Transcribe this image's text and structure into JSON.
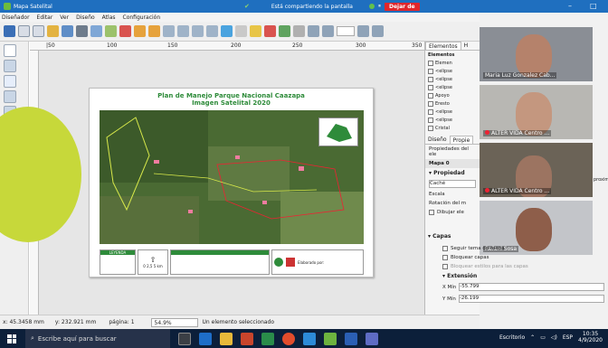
{
  "window": {
    "title": "Mapa Satelital",
    "share_text": "Está compartiendo la pantalla",
    "stop_label": "Dejar de",
    "minimize": "–",
    "maximize": "□"
  },
  "menu": [
    "Diseñador",
    "Editar",
    "Ver",
    "Diseño",
    "Atlas",
    "Configuración"
  ],
  "ruler": {
    "ticks": [
      "|50",
      "100",
      "150",
      "200",
      "250",
      "300",
      "350"
    ]
  },
  "map": {
    "title_line1": "Plan de Manejo Parque Nacional Caazapa",
    "title_line2": "Imagen Satelital 2020",
    "legend_title": "LEYENDA",
    "scale_text": "0    2,5    5 km",
    "credit": "Elaborado por:"
  },
  "panel": {
    "tab_elements": "Elementos",
    "tab_history": "H",
    "elements_header": "Elementos",
    "layers": [
      "Elemen",
      "<elipse",
      "<elipse",
      "<elipse",
      "Apoyo",
      "Eresto",
      "<elipse",
      "<elipse",
      "Cristal",
      "<elipse"
    ],
    "tab_design": "Diseño",
    "tab_props": "Propie",
    "props_label": "Propiedades del ele",
    "map_label": "Mapa 0",
    "props_section": "Propiedad",
    "cache_label": "Caché",
    "scale_label": "Escala",
    "rotation_label": "Rotación del m",
    "draw_items_label": "Dibujar ele",
    "layers_section": "Capas",
    "follow_theme": "Seguir tema de mapa",
    "lock_layers": "Bloquear capas",
    "lock_styles": "Bloquear estilos para las capas",
    "extent_section": "Extensión",
    "xmin_label": "X Mín",
    "xmin_value": "-55.799",
    "ymin_label": "Y Mín",
    "ymin_value": "-26.199",
    "side_label": "proxima"
  },
  "video": [
    {
      "name": "Maria Luz Gonzalez Cab..."
    },
    {
      "name": "ALTER VIDA Centro ..."
    },
    {
      "name": "ALTER VIDA Centro ..."
    },
    {
      "name": "Rafael Sosa"
    }
  ],
  "status": {
    "x": "x: 45.3458 mm",
    "y": "y: 232.921 mm",
    "page": "página: 1",
    "zoom": "54.9%",
    "selection": "Un elemento seleccionado"
  },
  "taskbar": {
    "search_placeholder": "Escribe aquí para buscar",
    "desk": "Escritorio",
    "lang": "ESP",
    "time": "10:35",
    "date": "4/9/2020"
  }
}
